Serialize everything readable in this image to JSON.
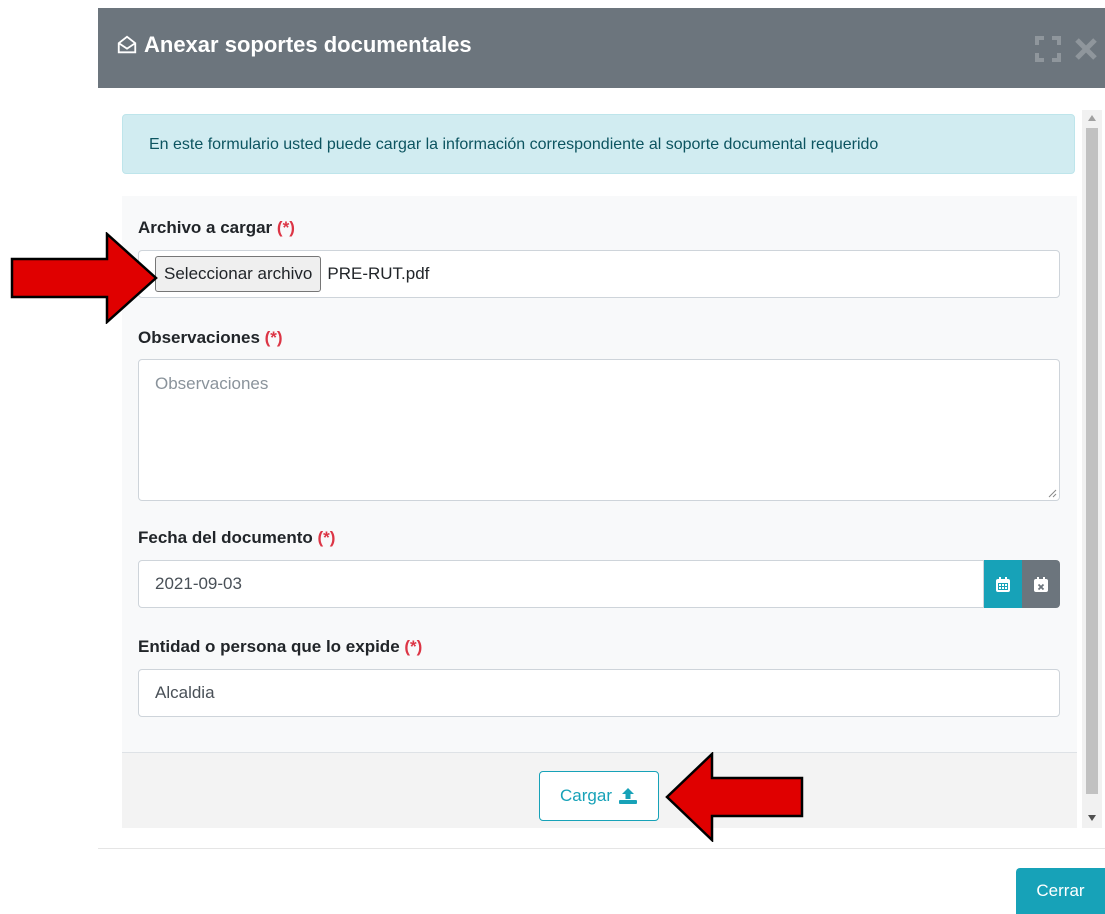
{
  "modal": {
    "title": "Anexar soportes documentales",
    "info_text": "En este formulario usted puede cargar la información correspondiente al soporte documental requerido"
  },
  "form": {
    "file_label": "Archivo a cargar",
    "file_button": "Seleccionar archivo",
    "file_name": "PRE-RUT.pdf",
    "obs_label": "Observaciones",
    "obs_placeholder": "Observaciones",
    "date_label": "Fecha del documento",
    "date_value": "2021-09-03",
    "entity_label": "Entidad o persona que lo expide",
    "entity_value": "Alcaldia",
    "required_mark": "(*)"
  },
  "footer": {
    "upload_button": "Cargar",
    "close_button": "Cerrar"
  },
  "colors": {
    "header_bg": "#6c757d",
    "accent": "#17a2b8",
    "required": "#dc3545",
    "annotation_arrow": "#e00000"
  }
}
